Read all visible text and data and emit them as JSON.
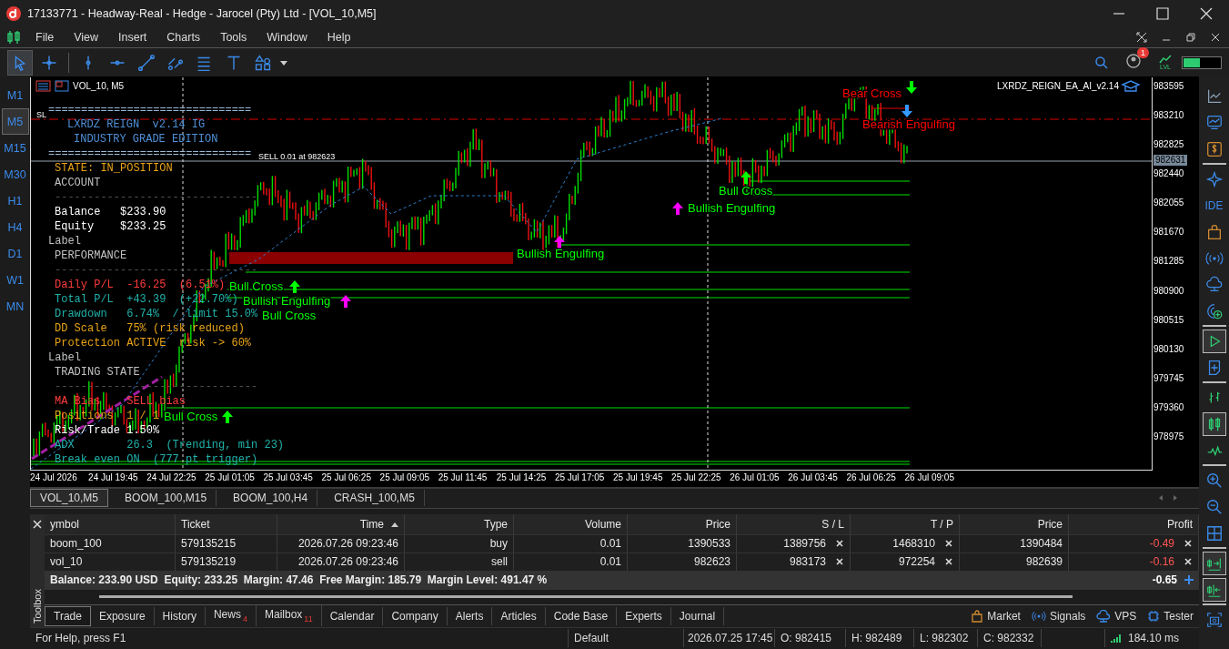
{
  "window": {
    "title": "17133771 - Headway-Real - Hedge - Jarocel (Pty) Ltd - [VOL_10,M5]"
  },
  "menu": [
    "File",
    "View",
    "Insert",
    "Charts",
    "Tools",
    "Window",
    "Help"
  ],
  "toolbar": {
    "tools": [
      {
        "selected": true
      },
      {
        "selected": false
      },
      {
        "selected": false
      },
      {
        "selected": false
      },
      {
        "selected": false
      },
      {
        "selected": false
      },
      {
        "selected": false
      },
      {
        "selected": false
      },
      {
        "selected": false
      }
    ],
    "notification_count": "1",
    "lvl": "LVL"
  },
  "timeframes": [
    {
      "label": "M1",
      "selected": false
    },
    {
      "label": "M5",
      "selected": true
    },
    {
      "label": "M15",
      "selected": false
    },
    {
      "label": "M30",
      "selected": false
    },
    {
      "label": "H1",
      "selected": false
    },
    {
      "label": "H4",
      "selected": false
    },
    {
      "label": "D1",
      "selected": false
    },
    {
      "label": "W1",
      "selected": false
    },
    {
      "label": "MN",
      "selected": false
    }
  ],
  "sidebar": {
    "ide": "IDE",
    "tester_run": {
      "on": true
    },
    "chart_types": [
      {
        "selected": false
      },
      {
        "selected": true
      },
      {
        "selected": false
      }
    ],
    "auto_scroll": {
      "on": true
    },
    "chart_shift": {
      "on": true
    }
  },
  "chart": {
    "symbol": "VOL_10, M5",
    "expert": "LXRDZ_REIGN_EA_AI_v2.14",
    "current_price": "982631",
    "line_labels": [
      "SL",
      "SELL 0.01 at 982623"
    ],
    "price_axis": [
      "983595",
      "983210",
      "982825",
      "982440",
      "982055",
      "981670",
      "981285",
      "980900",
      "980515",
      "980130",
      "979745",
      "979360",
      "978975"
    ],
    "time_axis": [
      "24 Jul 2026",
      "24 Jul 19:45",
      "24 Jul 22:25",
      "25 Jul 01:05",
      "25 Jul 03:45",
      "25 Jul 06:25",
      "25 Jul 09:05",
      "25 Jul 11:45",
      "25 Jul 14:25",
      "25 Jul 17:05",
      "25 Jul 19:45",
      "25 Jul 22:25",
      "26 Jul 01:05",
      "26 Jul 03:45",
      "26 Jul 06:25",
      "26 Jul 09:05"
    ],
    "panel": [
      {
        "kind": "rule",
        "text": "===============================",
        "color": "#9db8d8"
      },
      {
        "kind": "title",
        "text": "LXRDZ REIGN  v2.14 IG",
        "color": "#4f8fd6"
      },
      {
        "kind": "subtitle",
        "text": "INDUSTRY GRADE EDITION",
        "color": "#4f8fd6"
      },
      {
        "kind": "rule",
        "text": "===============================",
        "color": "#9db8d8"
      },
      {
        "kind": "text",
        "text": "STATE: IN_POSITION",
        "color": "#e8a317"
      },
      {
        "kind": "text",
        "text": "ACCOUNT",
        "color": "#c0c0c0"
      },
      {
        "kind": "text",
        "text": "-------------------------------",
        "color": "#555555"
      },
      {
        "kind": "text",
        "text": "Balance   $233.90",
        "color": "#ffffff"
      },
      {
        "kind": "text",
        "text": "Equity    $233.25",
        "color": "#ffffff"
      },
      {
        "kind": "label",
        "text": "Label",
        "color": "#c0c0c0"
      },
      {
        "kind": "text",
        "text": "PERFORMANCE",
        "color": "#c0c0c0"
      },
      {
        "kind": "text",
        "text": "-------------------------------",
        "color": "#555555"
      },
      {
        "kind": "text",
        "text": "Daily P/L  -16.25  (6.51%)",
        "color": "#ff3b3b"
      },
      {
        "kind": "text",
        "text": "Total P/L  +43.39  (+22.70%)",
        "color": "#20b2aa"
      },
      {
        "kind": "text",
        "text": "Drawdown   6.74%  / limit 15.0%",
        "color": "#20b2aa"
      },
      {
        "kind": "text",
        "text": "DD Scale   75% (risk reduced)",
        "color": "#e8a317"
      },
      {
        "kind": "text",
        "text": "Protection ACTIVE  risk -> 60%",
        "color": "#e8a317"
      },
      {
        "kind": "label",
        "text": "Label",
        "color": "#c0c0c0"
      },
      {
        "kind": "text",
        "text": "TRADING STATE",
        "color": "#c0c0c0"
      },
      {
        "kind": "text",
        "text": "-------------------------------",
        "color": "#555555"
      },
      {
        "kind": "text",
        "text": "MA Bias    SELL bias",
        "color": "#ff3b3b"
      },
      {
        "kind": "text",
        "text": "Positions  1 / 1",
        "color": "#e8a317"
      },
      {
        "kind": "text",
        "text": "Risk/Trade 1.50%",
        "color": "#ffffff"
      },
      {
        "kind": "text",
        "text": "ADX        26.3  (Trending, min 23)",
        "color": "#20b2aa"
      },
      {
        "kind": "text",
        "text": "Break even ON  (777 pt trigger)",
        "color": "#20b2aa"
      }
    ],
    "signals": [
      {
        "text": "Bear Cross",
        "color": "#ff0000"
      },
      {
        "text": "Bearish Engulfing",
        "color": "#ff0000"
      },
      {
        "text": "Bull Cross",
        "color": "#00ff00"
      },
      {
        "text": "Bullish Engulfing",
        "color": "#00ff00"
      },
      {
        "text": "Bullish Engulfing",
        "color": "#00ff00"
      },
      {
        "text": "Bull Cross",
        "color": "#00ff00"
      },
      {
        "text": "Bullish Engulfing",
        "color": "#00ff00"
      },
      {
        "text": "Bull Cross",
        "color": "#00ff00"
      },
      {
        "text": "Bull Cross",
        "color": "#00ff00"
      }
    ]
  },
  "chart_tabs": [
    {
      "label": "VOL_10,M5",
      "selected": true
    },
    {
      "label": "BOOM_100,M15",
      "selected": false
    },
    {
      "label": "BOOM_100,H4",
      "selected": false
    },
    {
      "label": "CRASH_100,M5",
      "selected": false
    }
  ],
  "trade_table": {
    "columns": [
      "ymbol",
      "Ticket",
      "Time",
      "Type",
      "Volume",
      "Price",
      "S / L",
      "T / P",
      "Price",
      "Profit"
    ],
    "rows": [
      {
        "cells": [
          "boom_100",
          "579135215",
          "2026.07.26 09:23:46",
          "buy",
          "0.01",
          "1390533",
          "1389756",
          "1468310",
          "1390484",
          "-0.49"
        ],
        "loss": true
      },
      {
        "cells": [
          "vol_10",
          "579135219",
          "2026.07.26 09:23:46",
          "sell",
          "0.01",
          "982623",
          "983173",
          "972254",
          "982639",
          "-0.16"
        ],
        "loss": true
      }
    ],
    "summary": "Balance: 233.90 USD  Equity: 233.25  Margin: 47.46  Free Margin: 185.79  Margin Level: 491.47 %",
    "total": "-0.65"
  },
  "toolbox": {
    "title": "Toolbox"
  },
  "bottom_tabs": [
    {
      "label": "Trade",
      "selected": true
    },
    {
      "label": "Exposure",
      "selected": false
    },
    {
      "label": "History",
      "selected": false
    },
    {
      "label": "News",
      "badge": "4",
      "selected": false
    },
    {
      "label": "Mailbox",
      "badge": "11",
      "selected": false
    },
    {
      "label": "Calendar",
      "selected": false
    },
    {
      "label": "Company",
      "selected": false
    },
    {
      "label": "Alerts",
      "selected": false
    },
    {
      "label": "Articles",
      "selected": false
    },
    {
      "label": "Code Base",
      "selected": false
    },
    {
      "label": "Experts",
      "selected": false
    },
    {
      "label": "Journal",
      "selected": false
    }
  ],
  "services": [
    {
      "label": "Market",
      "kind": "market"
    },
    {
      "label": "Signals",
      "kind": "signals"
    },
    {
      "label": "VPS",
      "kind": "vps"
    },
    {
      "label": "Tester",
      "kind": "tester"
    }
  ],
  "status_bar": {
    "help": "For Help, press F1",
    "profile": "Default",
    "time": "2026.07.25 17:45",
    "open": "O: 982415",
    "high": "H: 982489",
    "low": "L: 982302",
    "close": "C: 982332",
    "ping": "184.10 ms"
  }
}
